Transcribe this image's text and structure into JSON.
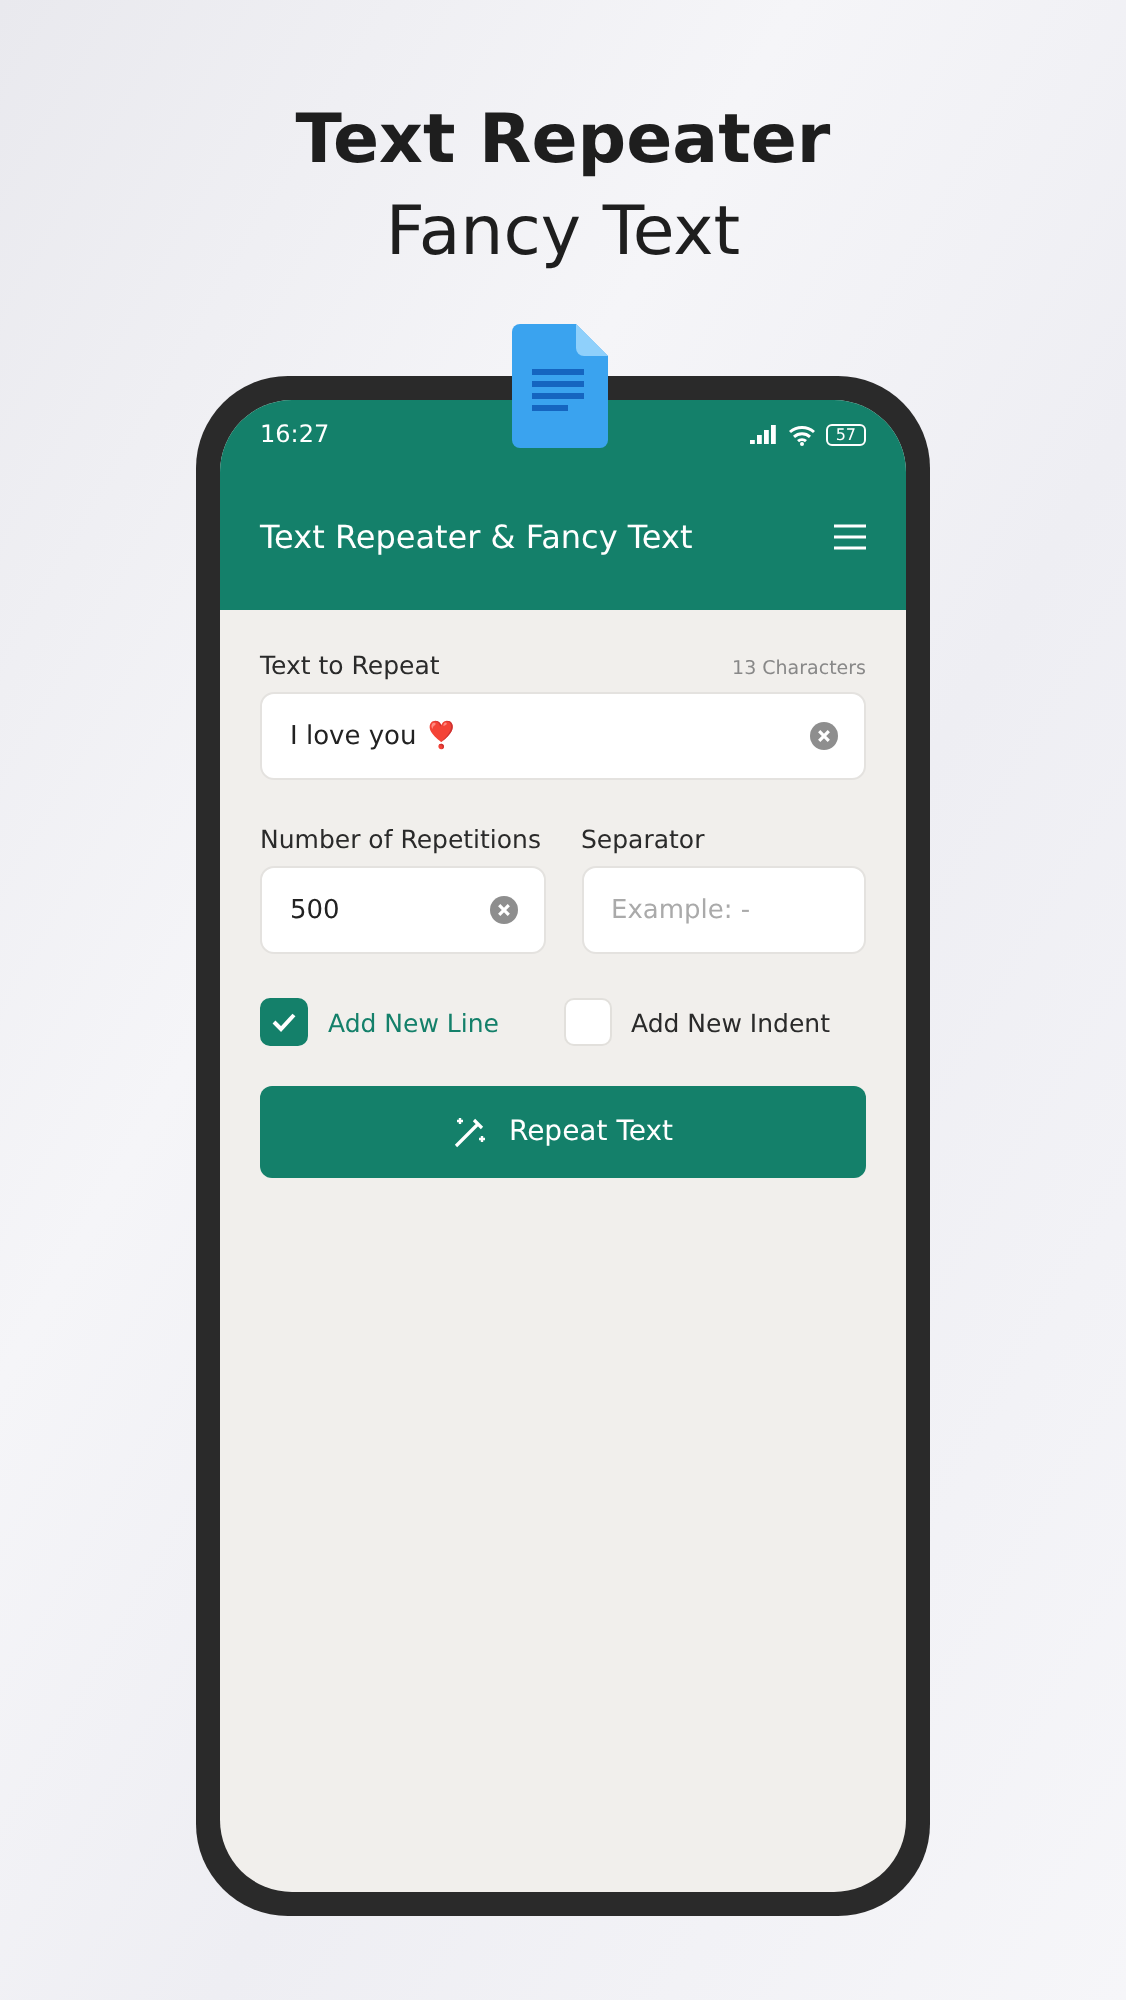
{
  "headline": {
    "title": "Text Repeater",
    "subtitle": "Fancy Text"
  },
  "status_bar": {
    "time": "16:27",
    "battery": "57"
  },
  "app_bar": {
    "title": "Text Repeater & Fancy Text"
  },
  "text_field": {
    "label": "Text to Repeat",
    "counter": "13 Characters",
    "value": "I love you ❣️"
  },
  "repetitions_field": {
    "label": "Number of Repetitions",
    "value": "500"
  },
  "separator_field": {
    "label": "Separator",
    "placeholder": "Example: -"
  },
  "options": [
    {
      "label": "Add New Line",
      "checked": true
    },
    {
      "label": "Add New Indent",
      "checked": false
    }
  ],
  "action_button": {
    "label": "Repeat Text"
  }
}
